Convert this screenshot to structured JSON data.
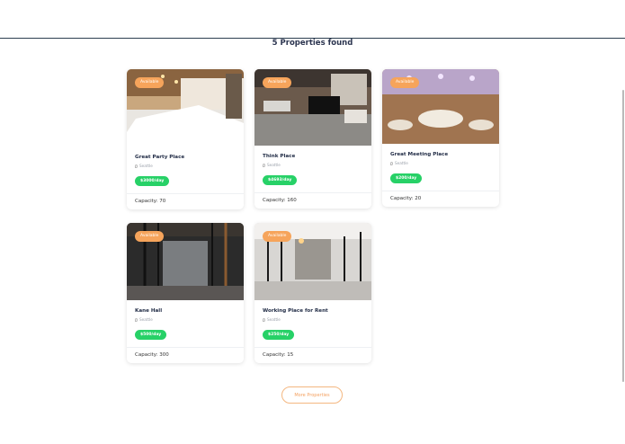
{
  "results_title": "5 Properties found",
  "properties": [
    {
      "status": "Available",
      "name": "Great Party Place",
      "location": "Seattle",
      "price": "$3000/day",
      "capacity": "Capacity: 70"
    },
    {
      "status": "Available",
      "name": "Think Place",
      "location": "Seattle",
      "price": "$4693/day",
      "capacity": "Capacity: 160"
    },
    {
      "status": "Available",
      "name": "Great Meeting Place",
      "location": "Seattle",
      "price": "$200/day",
      "capacity": "Capacity: 20"
    },
    {
      "status": "Available",
      "name": "Kane Hall",
      "location": "Seattle",
      "price": "$500/day",
      "capacity": "Capacity: 300"
    },
    {
      "status": "Available",
      "name": "Working Place for Rent",
      "location": "Seattle",
      "price": "$250/day",
      "capacity": "Capacity: 15"
    }
  ],
  "more_button": "More Properties",
  "colors": {
    "badge": "#f6a45b",
    "price": "#27d167",
    "button_border": "#f4b780"
  }
}
